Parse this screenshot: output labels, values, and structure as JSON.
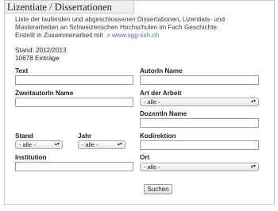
{
  "header": {
    "title": "Lizentiate / Dissertationen"
  },
  "description": {
    "line1": "Liste der laufenden und abgeschlossenen Dissertationen, Lizentiats- und",
    "line2": "Masterarbeiten an Schweizerischen Hochschulen im Fach Geschichte.",
    "line3_prefix": "Erstellt in Zusammenarbeit mit",
    "link_text": "www.sgg-ssh.ch"
  },
  "status": {
    "stand": "Stand: 2012/2013",
    "count": "10678 Einträge"
  },
  "form": {
    "text_label": "Text",
    "text_value": "",
    "autor_label": "AutorIn Name",
    "autor_value": "",
    "zweitautor_label": "ZweitautorIn Name",
    "zweitautor_value": "",
    "art_label": "Art der Arbeit",
    "art_selected": "- alle -",
    "dozent_label": "DozentIn Name",
    "dozent_value": "",
    "stand_label": "Stand",
    "stand_selected": "- alle -",
    "jahr_label": "Jahr",
    "jahr_selected": "- alle -",
    "kodirektion_label": "Kodirektion",
    "kodirektion_value": "",
    "institution_label": "Institution",
    "institution_value": "",
    "ort_label": "Ort",
    "ort_selected": "- alle -",
    "submit_label": "Suchen"
  },
  "icons": {
    "external_link": "external-link-icon",
    "select_arrow": "updown-arrow-icon"
  }
}
